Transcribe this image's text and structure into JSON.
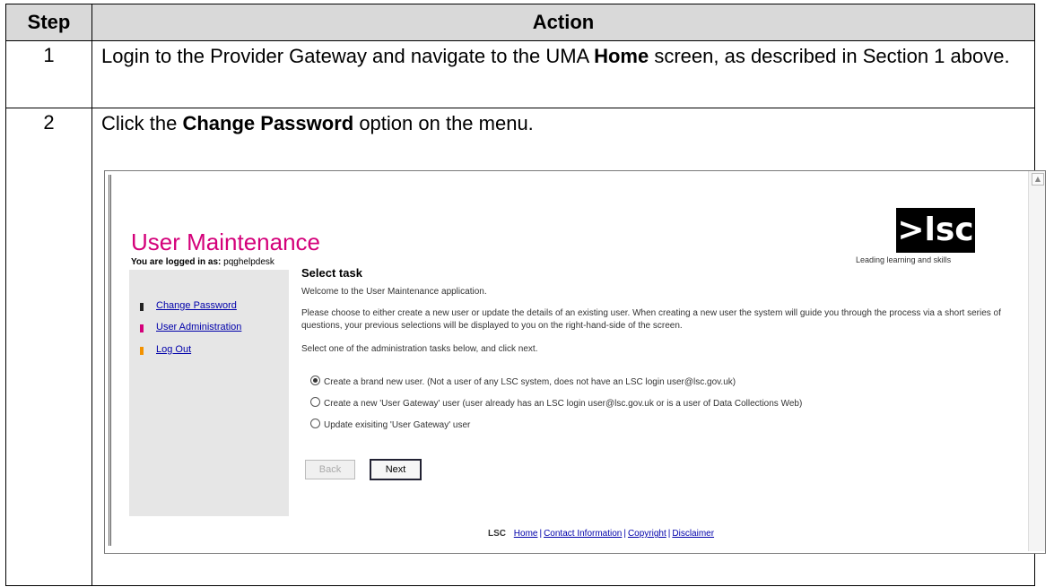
{
  "table": {
    "headers": {
      "step": "Step",
      "action": "Action"
    },
    "rows": [
      {
        "step": "1",
        "text_before": "Login to the Provider Gateway and navigate to the UMA ",
        "bold": "Home",
        "text_after": " screen, as described in Section 1 above."
      },
      {
        "step": "2",
        "text_before": "Click the ",
        "bold": "Change Password",
        "text_after": " option on the menu."
      }
    ]
  },
  "screenshot": {
    "title": "User Maintenance",
    "logo_text": ">lsc",
    "logo_tagline": "Leading learning and skills",
    "logged_in_label": "You are logged in as:",
    "logged_in_user": "pqghelpdesk",
    "sidebar": {
      "items": [
        {
          "label": "Change Password",
          "marker_color": "#222222"
        },
        {
          "label": "User Administration",
          "marker_color": "#d4007a"
        },
        {
          "label": "Log Out",
          "marker_color": "#f39200"
        }
      ]
    },
    "content": {
      "heading": "Select task",
      "welcome": "Welcome to the User Maintenance application.",
      "instructions": "Please choose to either create a new user or update the details of an existing user. When creating a new user the system will guide you through the process via a short series of questions, your previous selections will be displayed to you on the right-hand-side of the screen.",
      "prompt": "Select one of the administration tasks below, and click next.",
      "options": [
        {
          "label": "Create a brand new user. (Not a user of any LSC system, does not have an LSC login user@lsc.gov.uk)",
          "selected": true
        },
        {
          "label": "Create a new 'User Gateway' user (user already has an LSC login user@lsc.gov.uk or is a user of Data Collections Web)",
          "selected": false
        },
        {
          "label": "Update exisiting 'User Gateway' user",
          "selected": false
        }
      ],
      "back_label": "Back",
      "next_label": "Next"
    },
    "footer": {
      "label": "LSC",
      "links": [
        "Home",
        "Contact Information",
        "Copyright",
        "Disclaimer"
      ]
    }
  }
}
